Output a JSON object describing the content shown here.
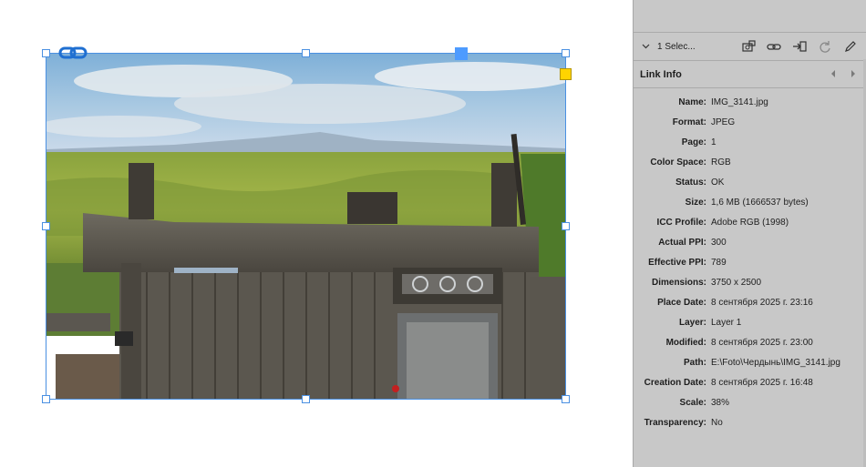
{
  "panel": {
    "selected_label": "1 Selec...",
    "section_title": "Link Info",
    "toolbar_icons": [
      "relink-from-folder-icon",
      "link-icon",
      "place-icon",
      "update-link-icon",
      "edit-original-icon"
    ],
    "rows": [
      {
        "label": "Name:",
        "value": "IMG_3141.jpg"
      },
      {
        "label": "Format:",
        "value": "JPEG"
      },
      {
        "label": "Page:",
        "value": "1"
      },
      {
        "label": "Color Space:",
        "value": "RGB"
      },
      {
        "label": "Status:",
        "value": "OK"
      },
      {
        "label": "Size:",
        "value": "1,6 MB (1666537 bytes)"
      },
      {
        "label": "ICC Profile:",
        "value": "Adobe RGB (1998)"
      },
      {
        "label": "Actual PPI:",
        "value": "300"
      },
      {
        "label": "Effective PPI:",
        "value": "789"
      },
      {
        "label": "Dimensions:",
        "value": "3750 x 2500"
      },
      {
        "label": "Place Date:",
        "value": "8 сентября 2025 г. 23:16"
      },
      {
        "label": "Layer:",
        "value": "Layer 1"
      },
      {
        "label": "Modified:",
        "value": "8 сентября 2025 г. 23:00"
      },
      {
        "label": "Path:",
        "value": "E:\\Foto\\Чердынь\\IMG_3141.jpg"
      },
      {
        "label": "Creation Date:",
        "value": "8 сентября 2025 г. 16:48"
      },
      {
        "label": "Scale:",
        "value": "38%"
      },
      {
        "label": "Transparency:",
        "value": "No"
      }
    ]
  },
  "colors": {
    "selection": "#4a90e2",
    "panel_bg": "#c8c8c8",
    "yellow_handle": "#ffd400"
  }
}
